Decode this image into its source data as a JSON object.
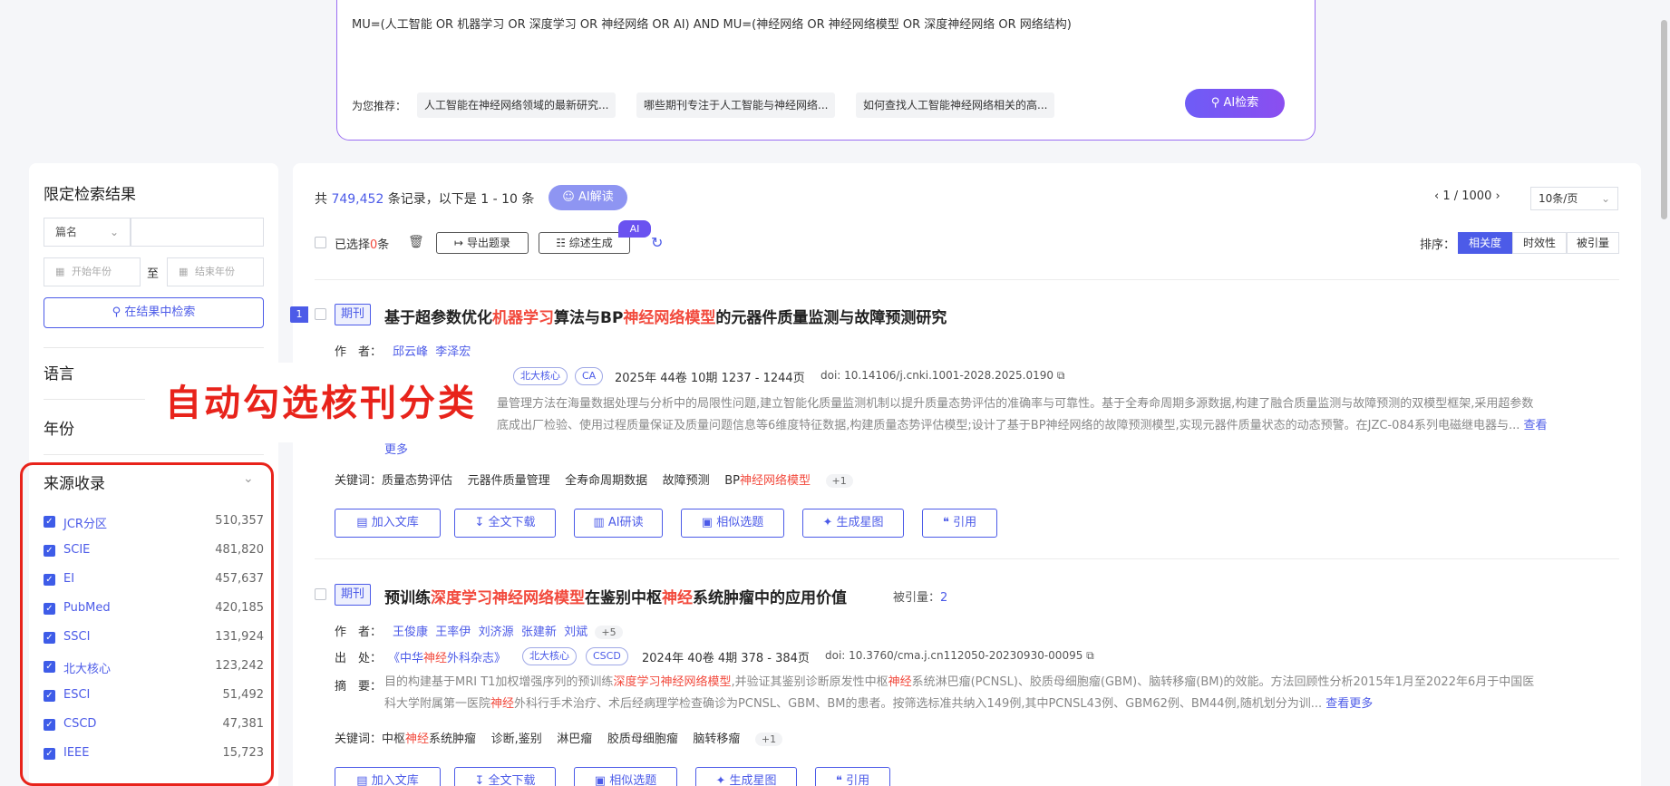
{
  "search": {
    "query": "MU=(人工智能 OR 机器学习 OR 深度学习 OR 神经网络 OR AI) AND MU=(神经网络 OR 神经网络模型 OR 深度神经网络 OR 网络结构)",
    "recommend_label": "为您推荐：",
    "recommendations": [
      "人工智能在神经网络领域的最新研究...",
      "哪些期刊专注于人工智能与神经网络...",
      "如何查找人工智能神经网络相关的高..."
    ],
    "ai_search_label": "AI检索"
  },
  "filter": {
    "title": "限定检索结果",
    "field_select": "篇名",
    "start_year_placeholder": "开始年份",
    "to_label": "至",
    "end_year_placeholder": "结束年份",
    "in_result_label": "在结果中检索",
    "sections": {
      "language": "语言",
      "year": "年份",
      "source": "来源收录"
    },
    "sources": [
      {
        "name": "JCR分区",
        "count": "510,357"
      },
      {
        "name": "SCIE",
        "count": "481,820"
      },
      {
        "name": "EI",
        "count": "457,637"
      },
      {
        "name": "PubMed",
        "count": "420,185"
      },
      {
        "name": "SSCI",
        "count": "131,924"
      },
      {
        "name": "北大核心",
        "count": "123,242"
      },
      {
        "name": "ESCI",
        "count": "51,492"
      },
      {
        "name": "CSCD",
        "count": "47,381"
      },
      {
        "name": "IEEE",
        "count": "15,723"
      }
    ]
  },
  "callout": {
    "text": "自动勾选核刊分类"
  },
  "results": {
    "total_prefix": "共",
    "total": "749,452",
    "total_suffix": "条记录，以下是 1 - 10 条",
    "ai_read_label": "AI解读",
    "pager": "1 / 1000",
    "page_size": "10条/页",
    "selected_prefix": "已选择",
    "selected_count": "0",
    "selected_suffix": "条",
    "export_label": "导出题录",
    "review_label": "综述生成",
    "ai_badge": "AI",
    "sort_label": "排序：",
    "sort_options": [
      "相关度",
      "时效性",
      "被引量"
    ],
    "items": [
      {
        "index": "1",
        "type": "期刊",
        "title_parts": [
          "基于超参数优化",
          "机器学习",
          "算法与BP",
          "神经网络模型",
          "的元器件质量监测与故障预测研究"
        ],
        "author_label": "作　者：",
        "authors": [
          "邱云峰",
          "李泽宏"
        ],
        "tags": [
          "北大核心",
          "CA"
        ],
        "issue": "2025年 44卷 10期 1237 - 1244页",
        "doi": "doi: 10.14106/j.cnki.1001-2028.2025.0190",
        "abstract_line1": "量管理方法在海量数据处理与分析中的局限性问题,建立智能化质量监测机制以提升质量态势评估的准确率与可靠性。基于全寿命周期多源数据,构建了融合质量监测与故障预测的双模型框架,采用超参数",
        "abstract_line2": "底成出厂检验、使用过程质量保证及质量问题信息等6维度特征数据,构建质量态势评估模型;设计了基于BP神经网络的故障预测模型,实现元器件质量状态的动态预警。在JZC-084系列电磁继电器与...",
        "see_more": "查看",
        "more": "更多",
        "keyword_label": "关键词：",
        "keywords": [
          "质量态势评估",
          "元器件质量管理",
          "全寿命周期数据",
          "故障预测"
        ],
        "kw_last_prefix": "BP",
        "kw_last_hl": "神经网络模型",
        "kw_more": "+1"
      },
      {
        "type": "期刊",
        "title_parts": [
          "预训练",
          "深度学习神经网络模型",
          "在鉴别中枢",
          "神经",
          "系统肿瘤中的应用价值"
        ],
        "cited_label": "被引量：",
        "cited": "2",
        "author_label": "作　者：",
        "authors": [
          "王俊康",
          "王率伊",
          "刘济源",
          "张建新",
          "刘斌"
        ],
        "authors_more": "+5",
        "source_label": "出　处：",
        "journal_parts": [
          "《中华",
          "神经",
          "外科杂志》"
        ],
        "tags": [
          "北大核心",
          "CSCD"
        ],
        "issue": "2024年 40卷 4期 378 - 384页",
        "doi": "doi: 10.3760/cma.j.cn112050-20230930-00095",
        "abstract_label": "摘　要：",
        "abstract_line1_a": "目的构建基于MRI T1加权增强序列的预训练",
        "abstract_line1_hl": "深度学习神经网络模型",
        "abstract_line1_b": ",并验证其鉴别诊断原发性中枢",
        "abstract_line1_hl2": "神经",
        "abstract_line1_c": "系统淋巴瘤(PCNSL)、胶质母细胞瘤(GBM)、脑转移瘤(BM)的效能。方法回顾性分析2015年1月至2022年6月于中国医",
        "abstract_line2_a": "科大学附属第一医院",
        "abstract_line2_hl": "神经",
        "abstract_line2_b": "外科行手术治疗、术后经病理学检查确诊为PCNSL、GBM、BM的患者。按筛选标准共纳入149例,其中PCNSL43例、GBM62例、BM44例,随机划分为训...",
        "see_more": "查看更多",
        "keyword_label": "关键词：",
        "kw1_a": "中枢",
        "kw1_hl": "神经",
        "kw1_b": "系统肿瘤",
        "keywords": [
          "诊断,鉴别",
          "淋巴瘤",
          "胶质母细胞瘤",
          "脑转移瘤"
        ],
        "kw_more": "+1"
      }
    ],
    "actions": [
      "加入文库",
      "全文下载",
      "AI研读",
      "相似选题",
      "生成星图",
      "引用"
    ]
  },
  "colors": {
    "accent": "#4c5be8",
    "highlight": "#f24a3d",
    "callout": "#e8231b"
  }
}
